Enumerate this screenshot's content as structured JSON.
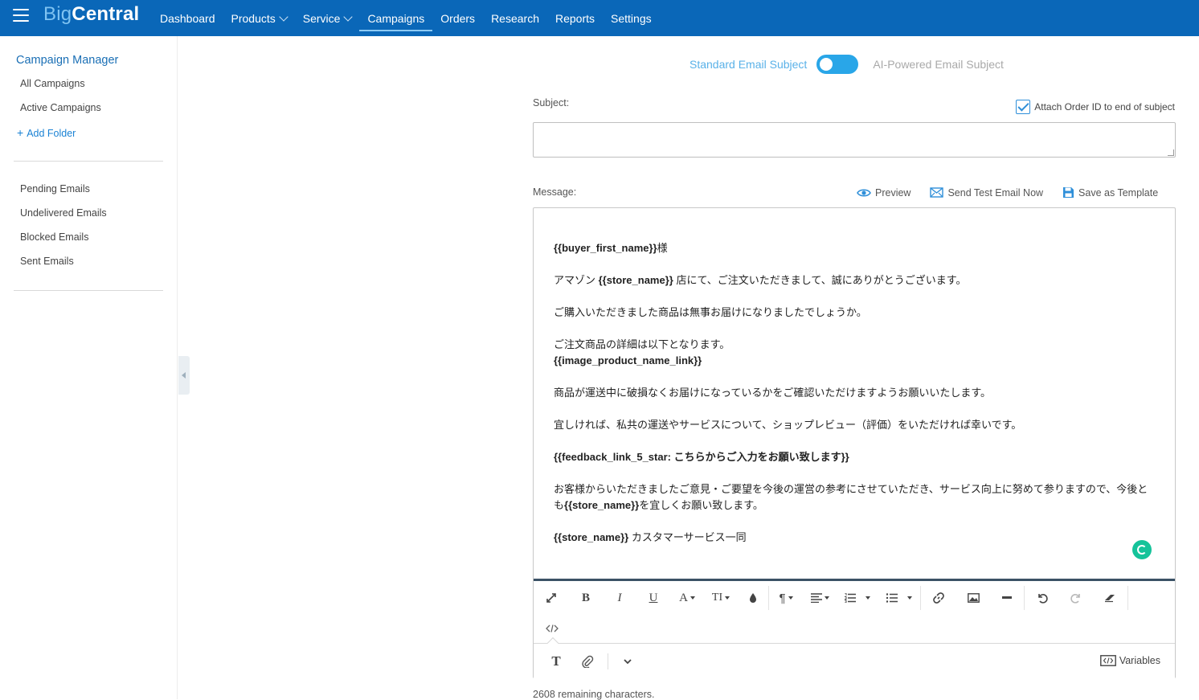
{
  "app": {
    "logo_part1": "Big",
    "logo_part2": "Central"
  },
  "nav": [
    {
      "label": "Dashboard",
      "dropdown": false,
      "active": false
    },
    {
      "label": "Products",
      "dropdown": true,
      "active": false
    },
    {
      "label": "Service",
      "dropdown": true,
      "active": false
    },
    {
      "label": "Campaigns",
      "dropdown": false,
      "active": true
    },
    {
      "label": "Orders",
      "dropdown": false,
      "active": false
    },
    {
      "label": "Research",
      "dropdown": false,
      "active": false
    },
    {
      "label": "Reports",
      "dropdown": false,
      "active": false
    },
    {
      "label": "Settings",
      "dropdown": false,
      "active": false
    }
  ],
  "sidebar": {
    "title": "Campaign Manager",
    "items1": [
      "All Campaigns",
      "Active Campaigns"
    ],
    "add_folder": "Add Folder",
    "add_folder_icon": "+",
    "items2": [
      "Pending Emails",
      "Undelivered Emails",
      "Blocked Emails",
      "Sent Emails"
    ]
  },
  "subject_mode": {
    "left_label": "Standard Email Subject",
    "right_label": "AI-Powered Email Subject",
    "ai_enabled": false
  },
  "subject": {
    "label": "Subject:",
    "value": "",
    "attach_label": "Attach Order ID to end of subject",
    "attach_checked": true
  },
  "message": {
    "label": "Message:",
    "actions": {
      "preview": "Preview",
      "send_test": "Send Test Email Now",
      "save_template": "Save as Template"
    },
    "body": [
      {
        "parts": [
          {
            "b": true,
            "t": "{{buyer_first_name}}"
          },
          {
            "b": false,
            "t": "様"
          }
        ]
      },
      {
        "parts": [
          {
            "b": false,
            "t": "アマゾン "
          },
          {
            "b": true,
            "t": "{{store_name}}"
          },
          {
            "b": false,
            "t": " 店にて、ご注文いただきまして、誠にありがとうございます。"
          }
        ]
      },
      {
        "parts": [
          {
            "b": false,
            "t": "ご購入いただきました商品は無事お届けになりましたでしょうか。"
          }
        ]
      },
      {
        "parts": [
          {
            "b": false,
            "t": "ご注文商品の詳細は以下となります。"
          },
          {
            "br": true
          },
          {
            "b": true,
            "t": "{{image_product_name_link}}"
          }
        ]
      },
      {
        "parts": [
          {
            "b": false,
            "t": "商品が運送中に破損なくお届けになっているかをご確認いただけますようお願いいたします。"
          }
        ]
      },
      {
        "parts": [
          {
            "b": false,
            "t": "宜しければ、私共の運送やサービスについて、ショップレビュー（評価）をいただければ幸いです。"
          }
        ]
      },
      {
        "parts": [
          {
            "b": true,
            "t": "{{feedback_link_5_star: こちらからご入力をお願い致します}}"
          }
        ]
      },
      {
        "parts": [
          {
            "b": false,
            "t": "お客様からいただきましたご意見・ご要望を今後の運営の参考にさせていただき、サービス向上に努めて参りますので、今後とも"
          },
          {
            "b": true,
            "t": "{{store_name}}"
          },
          {
            "b": false,
            "t": "を宜しくお願い致します。"
          }
        ]
      },
      {
        "parts": [
          {
            "b": true,
            "t": "{{store_name}}"
          },
          {
            "b": false,
            "t": " カスタマーサービス一同"
          }
        ]
      }
    ]
  },
  "toolbar": {
    "bold": "B",
    "italic": "I",
    "underline": "U",
    "font_color": "A",
    "font_size": "TI",
    "text_tab": "T",
    "variables": "Variables"
  },
  "remaining": "2608 remaining characters.",
  "colors": {
    "topbar": "#0a67b8",
    "accent": "#29a6e8",
    "link": "#1a82d4"
  }
}
